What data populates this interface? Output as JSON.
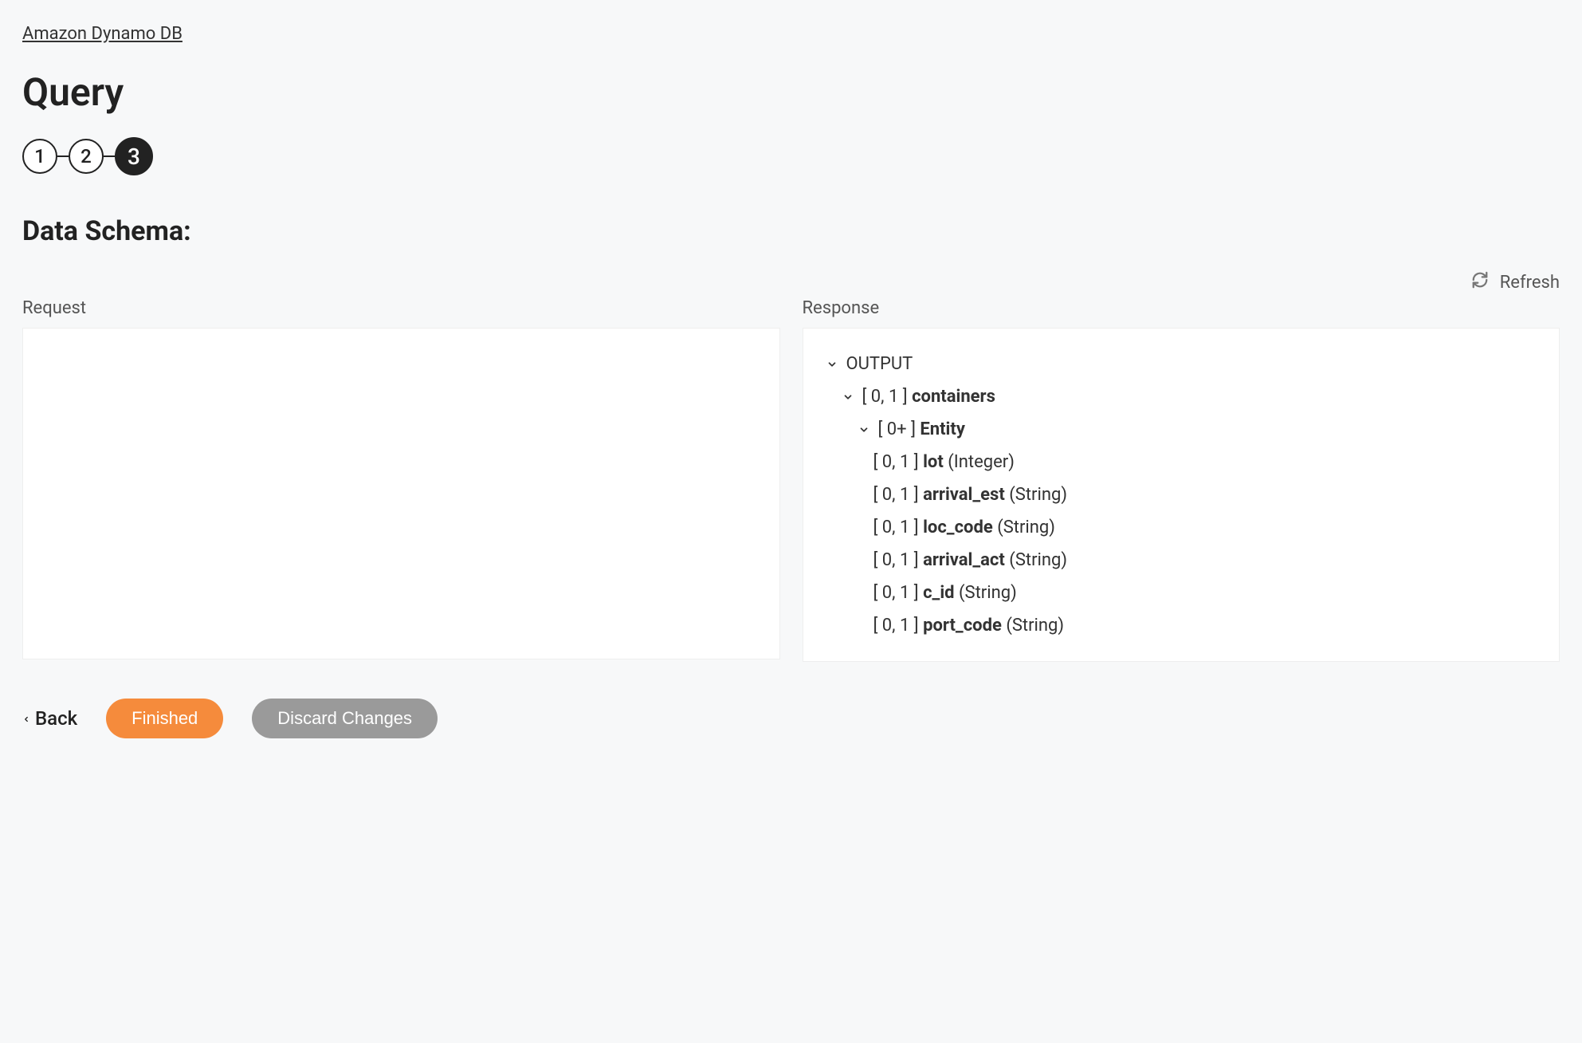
{
  "breadcrumb": "Amazon Dynamo DB",
  "page_title": "Query",
  "steps": {
    "step1": "1",
    "step2": "2",
    "step3": "3"
  },
  "section_title": "Data Schema:",
  "refresh_label": "Refresh",
  "panels": {
    "request_label": "Request",
    "response_label": "Response"
  },
  "response_tree": {
    "root_label": "OUTPUT",
    "containers_cardinality": "[ 0, 1 ]",
    "containers_name": "containers",
    "entity_cardinality": "[ 0+ ]",
    "entity_name": "Entity",
    "fields": {
      "f0_card": "[ 0, 1 ]",
      "f0_name": "lot",
      "f0_type": "(Integer)",
      "f1_card": "[ 0, 1 ]",
      "f1_name": "arrival_est",
      "f1_type": "(String)",
      "f2_card": "[ 0, 1 ]",
      "f2_name": "loc_code",
      "f2_type": "(String)",
      "f3_card": "[ 0, 1 ]",
      "f3_name": "arrival_act",
      "f3_type": "(String)",
      "f4_card": "[ 0, 1 ]",
      "f4_name": "c_id",
      "f4_type": "(String)",
      "f5_card": "[ 0, 1 ]",
      "f5_name": "port_code",
      "f5_type": "(String)"
    }
  },
  "footer": {
    "back_label": "Back",
    "finished_label": "Finished",
    "discard_label": "Discard Changes"
  }
}
